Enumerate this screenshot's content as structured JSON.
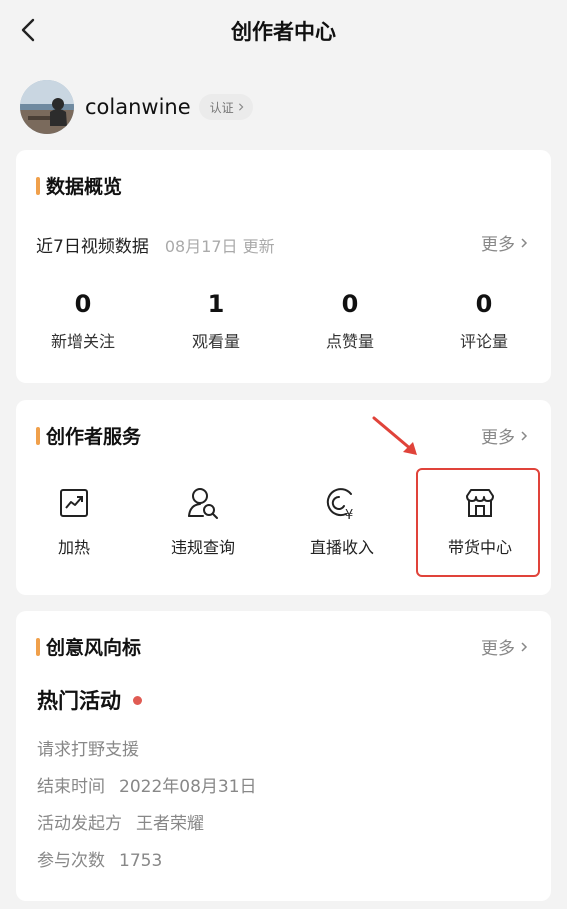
{
  "nav": {
    "title": "创作者中心"
  },
  "profile": {
    "username": "colanwine",
    "badge": "认证"
  },
  "overview": {
    "title": "数据概览",
    "subtitle": "近7日视频数据",
    "updated": "08月17日 更新",
    "more": "更多",
    "stats": [
      {
        "value": "0",
        "label": "新增关注"
      },
      {
        "value": "1",
        "label": "观看量"
      },
      {
        "value": "0",
        "label": "点赞量"
      },
      {
        "value": "0",
        "label": "评论量"
      }
    ]
  },
  "services": {
    "title": "创作者服务",
    "more": "更多",
    "items": [
      {
        "label": "加热",
        "icon": "trend-chart-icon"
      },
      {
        "label": "违规查询",
        "icon": "user-search-icon"
      },
      {
        "label": "直播收入",
        "icon": "live-income-icon"
      },
      {
        "label": "带货中心",
        "icon": "store-icon"
      }
    ]
  },
  "trends": {
    "title": "创意风向标",
    "more": "更多",
    "activity_title": "热门活动",
    "desc": "请求打野支援",
    "end_label": "结束时间",
    "end_value": "2022年08月31日",
    "sponsor_label": "活动发起方",
    "sponsor_value": "王者荣耀",
    "count_label": "参与次数",
    "count_value": "1753"
  },
  "colors": {
    "accent_bar": "#f0a04b",
    "highlight": "#e0433a",
    "dot": "#e05b53"
  }
}
